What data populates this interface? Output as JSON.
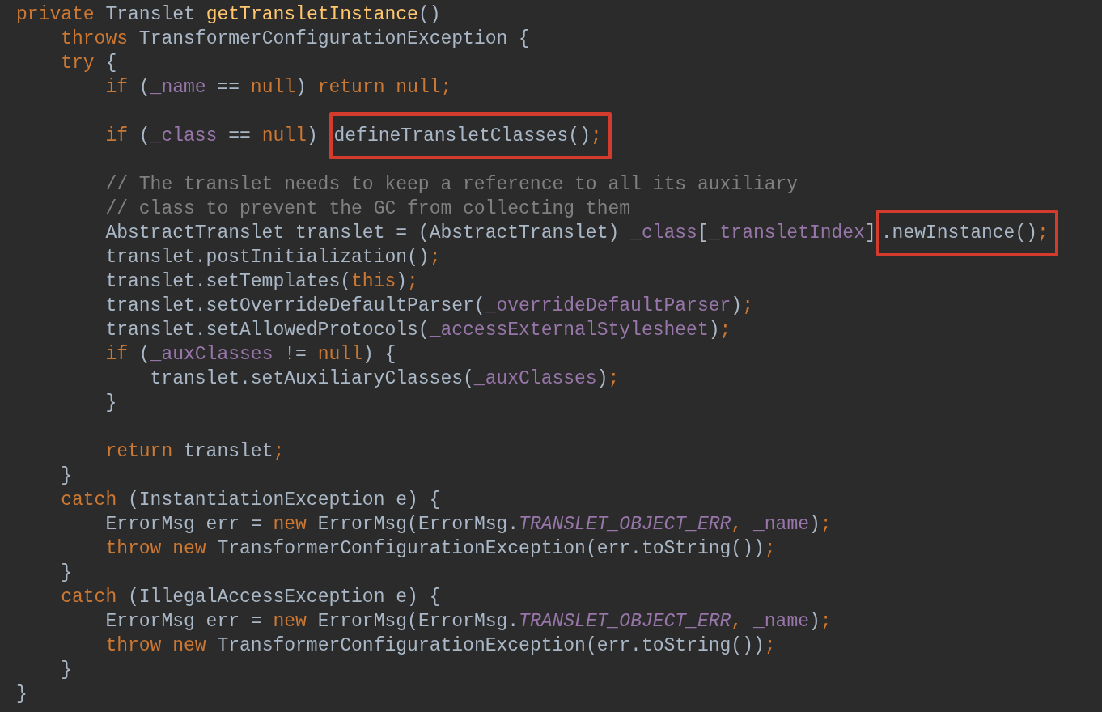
{
  "code_lines": [
    {
      "tokens": [
        {
          "kind": "kw",
          "text": "private"
        },
        {
          "kind": "space"
        },
        {
          "kind": "plain",
          "text": "Translet"
        },
        {
          "kind": "space"
        },
        {
          "kind": "method",
          "text": "getTransletInstance"
        },
        {
          "kind": "plain",
          "text": "()"
        }
      ],
      "children": [
        {
          "tokens": [
            {
              "kind": "kw",
              "text": "throws"
            },
            {
              "kind": "space"
            },
            {
              "kind": "plain",
              "text": "TransformerConfigurationException {"
            }
          ]
        },
        {
          "tokens": [
            {
              "kind": "kw",
              "text": "try"
            },
            {
              "kind": "space"
            },
            {
              "kind": "plain",
              "text": "{"
            }
          ],
          "children": [
            {
              "tokens": [
                {
                  "kind": "kw",
                  "text": "if"
                },
                {
                  "kind": "space"
                },
                {
                  "kind": "plain",
                  "text": "("
                },
                {
                  "kind": "field",
                  "text": "_name"
                },
                {
                  "kind": "space"
                },
                {
                  "kind": "plain",
                  "text": "=="
                },
                {
                  "kind": "space"
                },
                {
                  "kind": "kw",
                  "text": "null"
                },
                {
                  "kind": "plain",
                  "text": ")"
                },
                {
                  "kind": "space"
                },
                {
                  "kind": "kw",
                  "text": "return"
                },
                {
                  "kind": "space"
                },
                {
                  "kind": "kw",
                  "text": "null"
                },
                {
                  "kind": "punct",
                  "text": ";"
                }
              ]
            },
            {
              "gap_before": true,
              "tokens": [
                {
                  "kind": "kw",
                  "text": "if"
                },
                {
                  "kind": "space"
                },
                {
                  "kind": "plain",
                  "text": "("
                },
                {
                  "kind": "field",
                  "text": "_class"
                },
                {
                  "kind": "space"
                },
                {
                  "kind": "plain",
                  "text": "=="
                },
                {
                  "kind": "space"
                },
                {
                  "kind": "kw",
                  "text": "null"
                },
                {
                  "kind": "plain",
                  "text": ")"
                },
                {
                  "kind": "space"
                },
                {
                  "kind": "highlight",
                  "tokens": [
                    {
                      "kind": "plain",
                      "text": "defineTransletClasses()"
                    },
                    {
                      "kind": "punct",
                      "text": ";"
                    }
                  ]
                }
              ]
            },
            {
              "gap_before": true,
              "tokens": [
                {
                  "kind": "comment",
                  "text": "// The translet needs to keep a reference to all its auxiliary"
                }
              ]
            },
            {
              "tokens": [
                {
                  "kind": "comment",
                  "text": "// class to prevent the GC from collecting them"
                }
              ]
            },
            {
              "tokens": [
                {
                  "kind": "plain",
                  "text": "AbstractTranslet translet = (AbstractTranslet)"
                },
                {
                  "kind": "space"
                },
                {
                  "kind": "field",
                  "text": "_class"
                },
                {
                  "kind": "plain",
                  "text": "["
                },
                {
                  "kind": "field",
                  "text": "_transletIndex"
                },
                {
                  "kind": "plain",
                  "text": "]"
                },
                {
                  "kind": "highlight",
                  "tokens": [
                    {
                      "kind": "plain",
                      "text": ".newInstance()"
                    },
                    {
                      "kind": "punct",
                      "text": ";"
                    }
                  ]
                }
              ]
            },
            {
              "tokens": [
                {
                  "kind": "plain",
                  "text": "translet.postInitialization()"
                },
                {
                  "kind": "punct",
                  "text": ";"
                }
              ]
            },
            {
              "tokens": [
                {
                  "kind": "plain",
                  "text": "translet.setTemplates("
                },
                {
                  "kind": "kw",
                  "text": "this"
                },
                {
                  "kind": "plain",
                  "text": ")"
                },
                {
                  "kind": "punct",
                  "text": ";"
                }
              ]
            },
            {
              "tokens": [
                {
                  "kind": "plain",
                  "text": "translet.setOverrideDefaultParser("
                },
                {
                  "kind": "field",
                  "text": "_overrideDefaultParser"
                },
                {
                  "kind": "plain",
                  "text": ")"
                },
                {
                  "kind": "punct",
                  "text": ";"
                }
              ]
            },
            {
              "tokens": [
                {
                  "kind": "plain",
                  "text": "translet.setAllowedProtocols("
                },
                {
                  "kind": "field",
                  "text": "_accessExternalStylesheet"
                },
                {
                  "kind": "plain",
                  "text": ")"
                },
                {
                  "kind": "punct",
                  "text": ";"
                }
              ]
            },
            {
              "tokens": [
                {
                  "kind": "kw",
                  "text": "if"
                },
                {
                  "kind": "space"
                },
                {
                  "kind": "plain",
                  "text": "("
                },
                {
                  "kind": "field",
                  "text": "_auxClasses"
                },
                {
                  "kind": "space"
                },
                {
                  "kind": "plain",
                  "text": "!="
                },
                {
                  "kind": "space"
                },
                {
                  "kind": "kw",
                  "text": "null"
                },
                {
                  "kind": "plain",
                  "text": ") {"
                }
              ],
              "children": [
                {
                  "tokens": [
                    {
                      "kind": "plain",
                      "text": "translet.setAuxiliaryClasses("
                    },
                    {
                      "kind": "field",
                      "text": "_auxClasses"
                    },
                    {
                      "kind": "plain",
                      "text": ")"
                    },
                    {
                      "kind": "punct",
                      "text": ";"
                    }
                  ]
                }
              ]
            },
            {
              "tokens": [
                {
                  "kind": "plain",
                  "text": "}"
                }
              ]
            },
            {
              "gap_before": true,
              "tokens": [
                {
                  "kind": "kw",
                  "text": "return"
                },
                {
                  "kind": "space"
                },
                {
                  "kind": "plain",
                  "text": "translet"
                },
                {
                  "kind": "punct",
                  "text": ";"
                }
              ]
            }
          ]
        },
        {
          "tokens": [
            {
              "kind": "plain",
              "text": "}"
            }
          ]
        },
        {
          "tokens": [
            {
              "kind": "kw",
              "text": "catch"
            },
            {
              "kind": "space"
            },
            {
              "kind": "plain",
              "text": "(InstantiationException e) {"
            }
          ],
          "children": [
            {
              "tokens": [
                {
                  "kind": "plain",
                  "text": "ErrorMsg err ="
                },
                {
                  "kind": "space"
                },
                {
                  "kind": "kw",
                  "text": "new"
                },
                {
                  "kind": "space"
                },
                {
                  "kind": "plain",
                  "text": "ErrorMsg(ErrorMsg."
                },
                {
                  "kind": "const",
                  "text": "TRANSLET_OBJECT_ERR"
                },
                {
                  "kind": "punct",
                  "text": ","
                },
                {
                  "kind": "space"
                },
                {
                  "kind": "field",
                  "text": "_name"
                },
                {
                  "kind": "plain",
                  "text": ")"
                },
                {
                  "kind": "punct",
                  "text": ";"
                }
              ]
            },
            {
              "tokens": [
                {
                  "kind": "kw",
                  "text": "throw"
                },
                {
                  "kind": "space"
                },
                {
                  "kind": "kw",
                  "text": "new"
                },
                {
                  "kind": "space"
                },
                {
                  "kind": "plain",
                  "text": "TransformerConfigurationException(err.toString())"
                },
                {
                  "kind": "punct",
                  "text": ";"
                }
              ]
            }
          ]
        },
        {
          "tokens": [
            {
              "kind": "plain",
              "text": "}"
            }
          ]
        },
        {
          "tokens": [
            {
              "kind": "kw",
              "text": "catch"
            },
            {
              "kind": "space"
            },
            {
              "kind": "plain",
              "text": "(IllegalAccessException e) {"
            }
          ],
          "children": [
            {
              "tokens": [
                {
                  "kind": "plain",
                  "text": "ErrorMsg err ="
                },
                {
                  "kind": "space"
                },
                {
                  "kind": "kw",
                  "text": "new"
                },
                {
                  "kind": "space"
                },
                {
                  "kind": "plain",
                  "text": "ErrorMsg(ErrorMsg."
                },
                {
                  "kind": "const",
                  "text": "TRANSLET_OBJECT_ERR"
                },
                {
                  "kind": "punct",
                  "text": ","
                },
                {
                  "kind": "space"
                },
                {
                  "kind": "field",
                  "text": "_name"
                },
                {
                  "kind": "plain",
                  "text": ")"
                },
                {
                  "kind": "punct",
                  "text": ";"
                }
              ]
            },
            {
              "tokens": [
                {
                  "kind": "kw",
                  "text": "throw"
                },
                {
                  "kind": "space"
                },
                {
                  "kind": "kw",
                  "text": "new"
                },
                {
                  "kind": "space"
                },
                {
                  "kind": "plain",
                  "text": "TransformerConfigurationException(err.toString())"
                },
                {
                  "kind": "punct",
                  "text": ";"
                }
              ]
            }
          ]
        },
        {
          "tokens": [
            {
              "kind": "plain",
              "text": "}"
            }
          ]
        }
      ]
    },
    {
      "tokens": [
        {
          "kind": "plain",
          "text": "}"
        }
      ]
    }
  ]
}
